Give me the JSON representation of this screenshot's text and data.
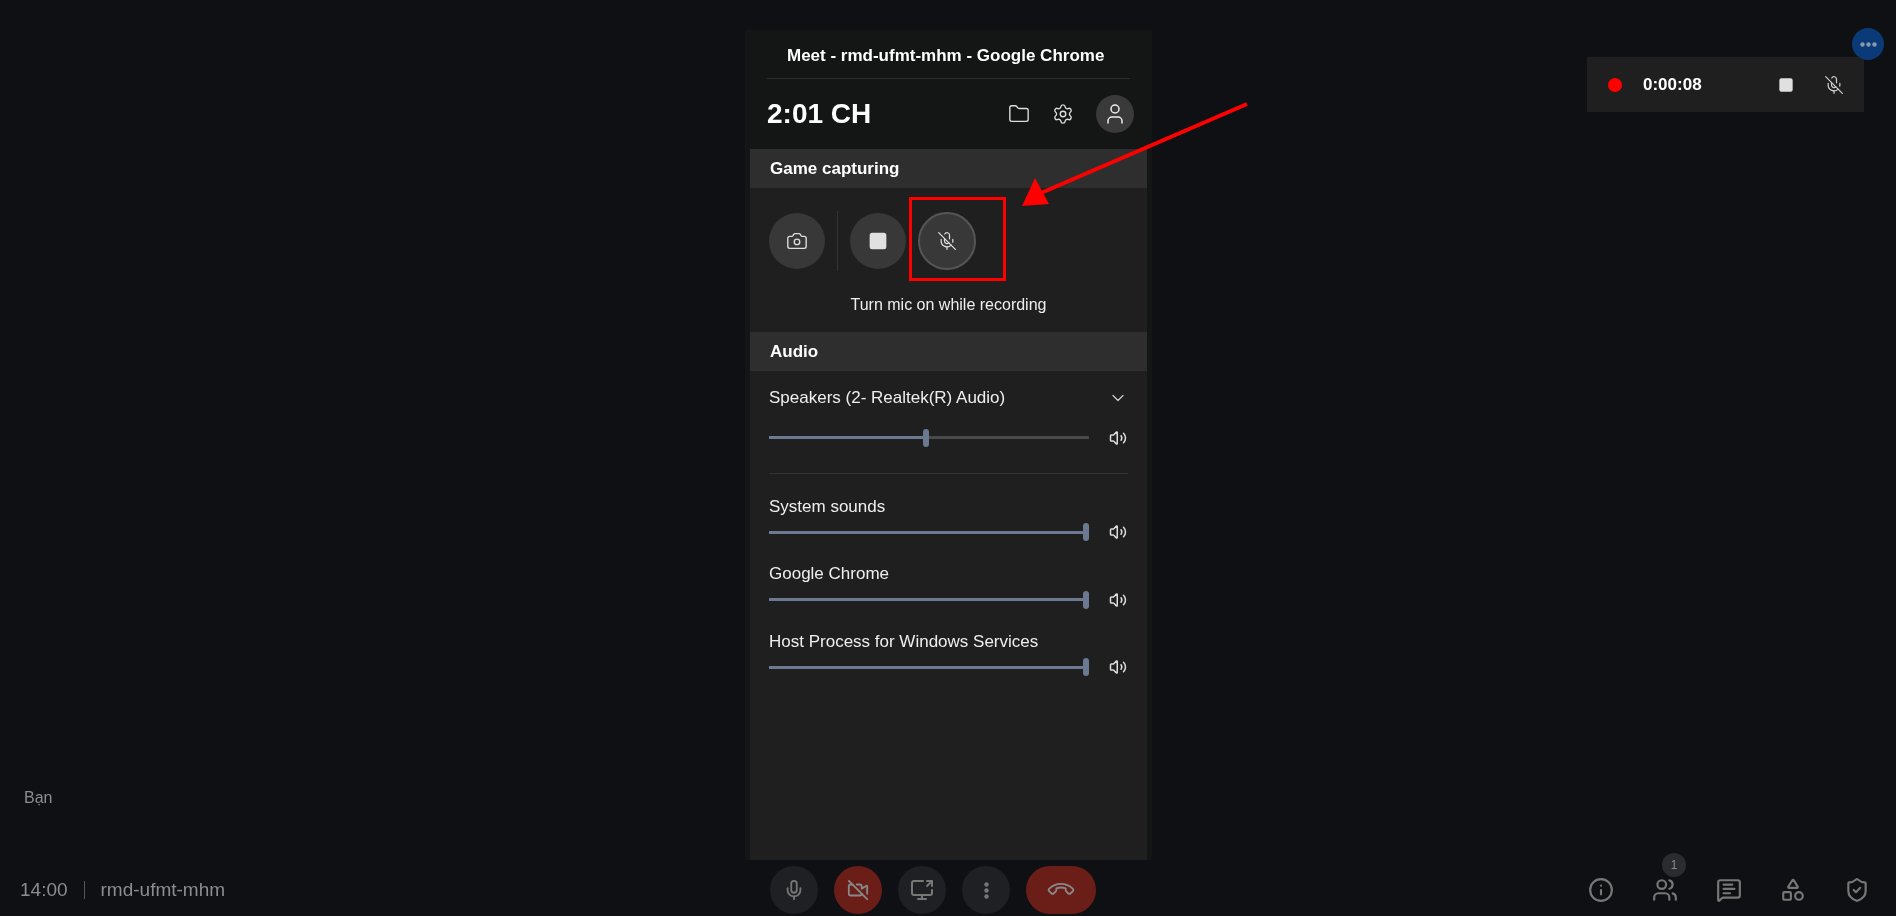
{
  "overlay_window": {
    "title": "Meet - rmd-ufmt-mhm - Google Chrome",
    "time": "2:01 CH"
  },
  "capture": {
    "header": "Game capturing",
    "mic_on": false,
    "caption": "Turn mic on while recording"
  },
  "audio": {
    "header": "Audio",
    "device": {
      "name": "Speakers (2- Realtek(R) Audio)",
      "level": 0.5
    },
    "apps": [
      {
        "name": "System sounds",
        "level": 1
      },
      {
        "name": "Google Chrome",
        "level": 1
      },
      {
        "name": "Host Process for Windows Services",
        "level": 1
      }
    ]
  },
  "recording": {
    "elapsed": "0:00:08",
    "mic_on": false
  },
  "meet": {
    "participant_name": "Bạn",
    "time": "14:00",
    "meeting_code": "rmd-ufmt-mhm",
    "people_count": "1",
    "mic_on": true,
    "camera_on": false
  }
}
